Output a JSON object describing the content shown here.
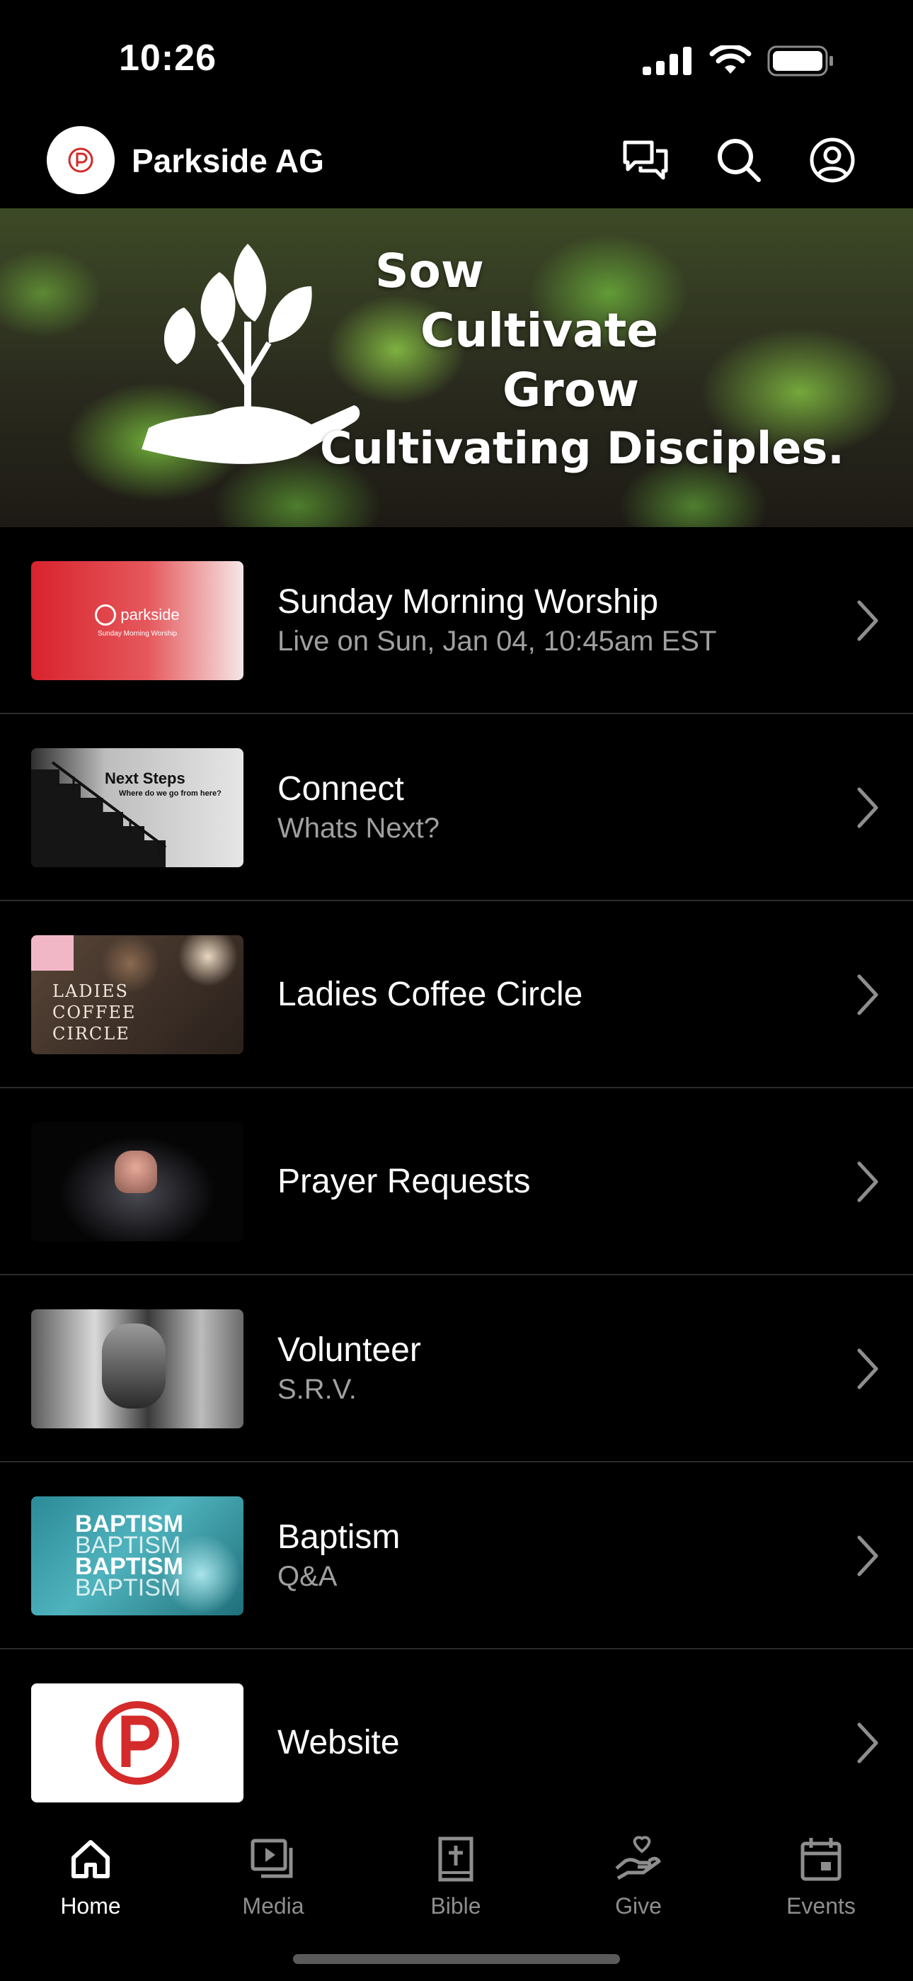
{
  "status_bar": {
    "time": "10:26"
  },
  "header": {
    "title": "Parkside AG"
  },
  "banner": {
    "line1": "Sow",
    "line2": "Cultivate",
    "line3": "Grow",
    "line4": "Cultivating Disciples."
  },
  "items": [
    {
      "title": "Sunday Morning Worship",
      "subtitle": "Live on Sun, Jan 04, 10:45am EST",
      "thumb_text": "parkside",
      "thumb_sub": "Sunday Morning Worship"
    },
    {
      "title": "Connect",
      "subtitle": "Whats Next?",
      "thumb_text": "Next Steps",
      "thumb_sub": "Where do we go from here?"
    },
    {
      "title": "Ladies Coffee Circle",
      "thumb_text": "LADIES COFFEE CIRCLE"
    },
    {
      "title": "Prayer Requests"
    },
    {
      "title": "Volunteer",
      "subtitle": "S.R.V."
    },
    {
      "title": "Baptism",
      "subtitle": "Q&A",
      "thumb_text": "BAPTISM"
    },
    {
      "title": "Website"
    }
  ],
  "tabs": [
    {
      "label": "Home",
      "icon": "home-icon",
      "active": true
    },
    {
      "label": "Media",
      "icon": "media-icon"
    },
    {
      "label": "Bible",
      "icon": "bible-icon"
    },
    {
      "label": "Give",
      "icon": "give-icon"
    },
    {
      "label": "Events",
      "icon": "events-icon"
    }
  ],
  "colors": {
    "accent": "#d42a2a",
    "background": "#000000",
    "divider": "#2b2b2b",
    "subtitle": "#a0a0a0"
  }
}
